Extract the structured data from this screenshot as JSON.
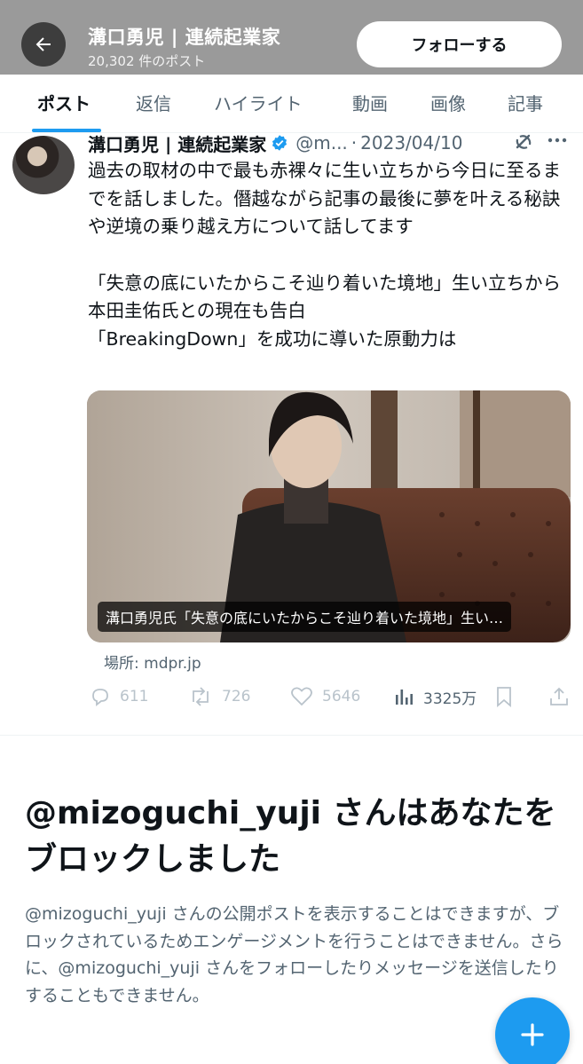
{
  "header": {
    "title": "溝口勇児 | 連続起業家",
    "post_count": "20,302 件のポスト",
    "follow_label": "フォローする",
    "back_icon": "arrow-left-icon"
  },
  "tabs": [
    {
      "label": "ポスト",
      "active": true
    },
    {
      "label": "返信",
      "active": false
    },
    {
      "label": "ハイライト",
      "active": false
    },
    {
      "label": "動画",
      "active": false
    },
    {
      "label": "画像",
      "active": false
    },
    {
      "label": "記事",
      "active": false
    }
  ],
  "post": {
    "author_name": "溝口勇児 | 連続起業家",
    "handle": "@m...",
    "separator": "·",
    "date": "2023/04/10",
    "paragraph1": "過去の取材の中で最も赤裸々に生い立ちから今日に至るまでを話しました。僭越ながら記事の最後に夢を叶える秘訣や逆境の乗り越え方について話してます",
    "paragraph2": "「失意の底にいたからこそ辿り着いた境地」生い立ちから本田圭佑氏との現在も告白\n「BreakingDown」を成功に導いた原動力は",
    "card_caption": "溝口勇児氏「失意の底にいたからこそ辿り着いた境地」生い…",
    "card_source": "場所: mdpr.jp",
    "replies": "611",
    "reposts": "726",
    "likes": "5646",
    "views": "3325万"
  },
  "block_notice": {
    "title": "@mizoguchi_yuji さんはあなたをブロックしました",
    "description": "@mizoguchi_yuji さんの公開ポストを表示することはできますが、ブロックされているためエンゲージメントを行うことはできません。さらに、@mizoguchi_yuji さんをフォローしたりメッセージを送信したりすることもできません。"
  },
  "colors": {
    "accent": "#1d9bf0",
    "header_bg": "#9a9a9a",
    "secondary_text": "#536471"
  }
}
